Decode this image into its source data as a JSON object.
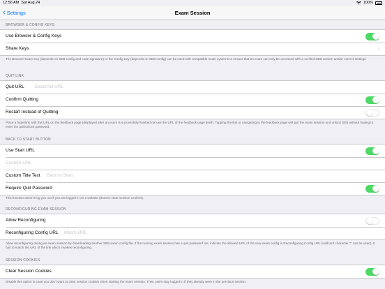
{
  "status": {
    "time": "12:56 AM",
    "date": "Sat Aug 24",
    "battery": "100%"
  },
  "nav": {
    "back_label": "Settings",
    "title": "Exam Session"
  },
  "sections": {
    "browser": {
      "header": "BROWSER & CONFIG KEYS",
      "use_keys": "Use Browser & Config Keys",
      "share_keys": "Share Keys",
      "footer": "The Browser Exam Key (depends on SEB config and code signature) or the Config Key (depends on SEB config) can be used with compatible exam systems to ensure that an exam can only be accessed with a verified SEB version and/or correct settings."
    },
    "quit": {
      "header": "QUIT LINK",
      "quit_url": "Quit URL",
      "quit_url_placeholder": "Exact full URL",
      "confirm": "Confirm Quitting",
      "restart": "Restart Instead of Quitting",
      "footer": "Place a hyperlink with this URL on the feedback page (displayed after an exam is successfully finished (or use the URL of the feedback page itself). Tapping the link or navigating to the feedback page will quit the exam session and unlock SEB without having to enter the quit/unlock password."
    },
    "back": {
      "header": "BACK TO START BUTTON",
      "use_start": "Use Start URL",
      "custom_url_placeholder": "Custom URL",
      "custom_title": "Custom Title Text",
      "custom_title_placeholder": "Back to Start",
      "require_pw": "Require Quit Password",
      "footer": "This function doesn't log you out if you are logged in on a website (doesn't clear session cookies)."
    },
    "reconf": {
      "header": "RECONFIGURING EXAM SESSION",
      "allow": "Allow Reconfiguring",
      "config_url": "Reconfiguring Config URL",
      "config_url_placeholder": "Match URL",
      "footer": "Allow reconfiguring during an exam session by downloading another SEB exam config file. If the running exam session has a quit password set, indicate the allowed URL of the new exam config in Reconfiguring Config URL (wildcard character '*' can be used). It has to match the URL of the link which invokes reconfiguring."
    },
    "cookies": {
      "header": "SESSION COOKIES",
      "clear": "Clear Session Cookies",
      "footer": "Disable this option in case you don't want to clear session cookies when starting the exam session. Then users stay logged in if they already were in the previous session."
    }
  },
  "toggles": {
    "use_keys": true,
    "confirm": true,
    "restart": false,
    "use_start": true,
    "require_pw": true,
    "allow": false,
    "clear": true
  },
  "colors": {
    "accent": "#007aff",
    "toggle_on": "#4cd964"
  },
  "icons": {
    "back": "chevron-left-icon",
    "wifi": "wifi-icon",
    "battery": "battery-icon",
    "disclosure": "chevron-right-icon"
  }
}
